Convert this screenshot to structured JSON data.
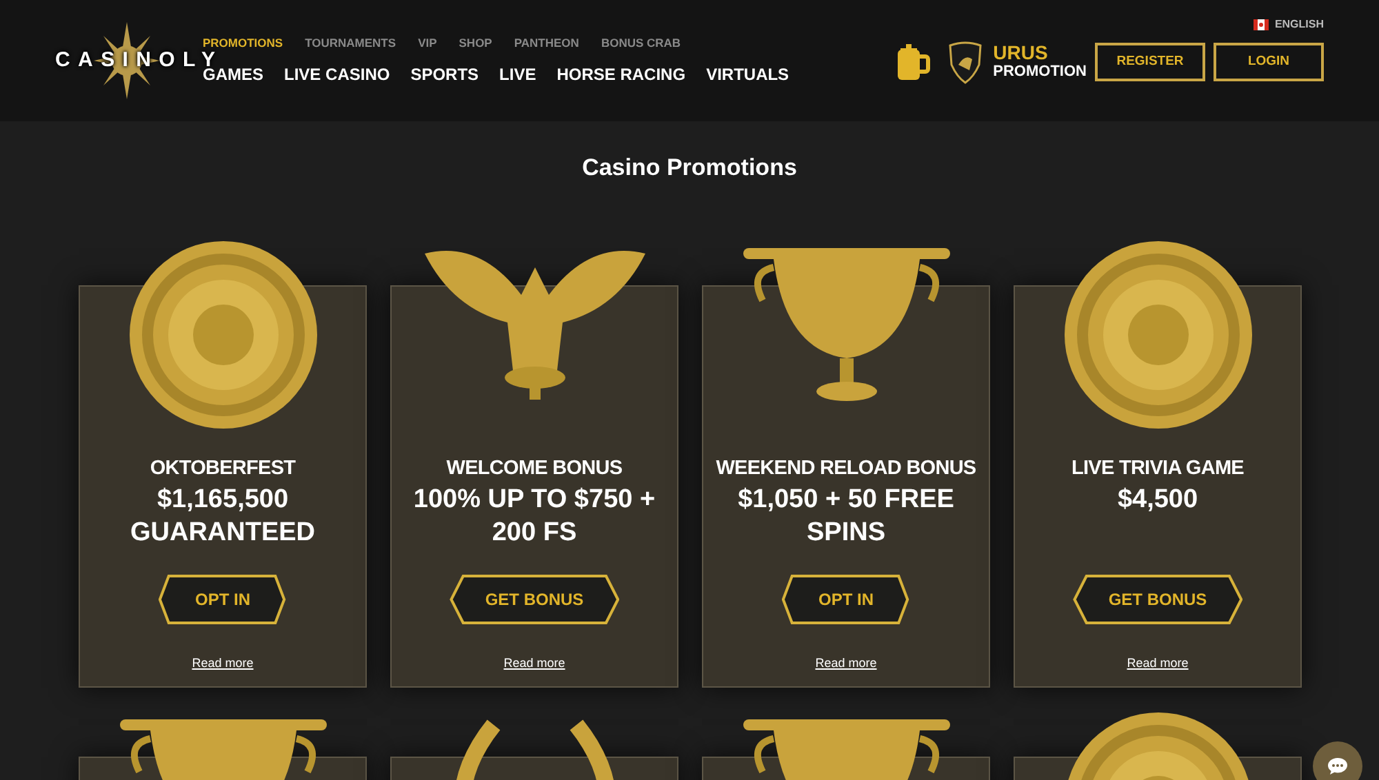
{
  "header": {
    "logo": "CASINOLY",
    "top_nav": [
      {
        "label": "PROMOTIONS",
        "selected": true
      },
      {
        "label": "TOURNAMENTS",
        "selected": false
      },
      {
        "label": "VIP",
        "selected": false
      },
      {
        "label": "SHOP",
        "selected": false
      },
      {
        "label": "PANTHEON",
        "selected": false
      },
      {
        "label": "BONUS CRAB",
        "selected": false
      }
    ],
    "main_nav": [
      "GAMES",
      "LIVE CASINO",
      "SPORTS",
      "LIVE",
      "HORSE RACING",
      "VIRTUALS"
    ],
    "language": "ENGLISH",
    "promo": {
      "line_1": "URUS",
      "line_2": "PROMOTION"
    },
    "buttons": [
      "REGISTER",
      "LOGIN"
    ]
  },
  "page_title": "Casino Promotions",
  "promotions": [
    {
      "kind": "medallion",
      "title": "OKTOBERFEST",
      "amount": "$1,165,500 GUARANTEED",
      "button": "OPT IN",
      "link": "Read more"
    },
    {
      "kind": "eagle",
      "title": "WELCOME BONUS",
      "amount": "100% UP TO $750 + 200 FS",
      "button": "GET BONUS",
      "link": "Read more"
    },
    {
      "kind": "cup",
      "title": "WEEKEND RELOAD BONUS",
      "amount": "$1,050 + 50 FREE SPINS",
      "button": "OPT IN",
      "link": "Read more"
    },
    {
      "kind": "medallion",
      "title": "LIVE TRIVIA GAME",
      "amount": "$4,500",
      "button": "GET BONUS",
      "link": "Read more"
    },
    {
      "kind": "cup"
    },
    {
      "kind": "wreath"
    },
    {
      "kind": "cup"
    },
    {
      "kind": "medallion"
    }
  ]
}
